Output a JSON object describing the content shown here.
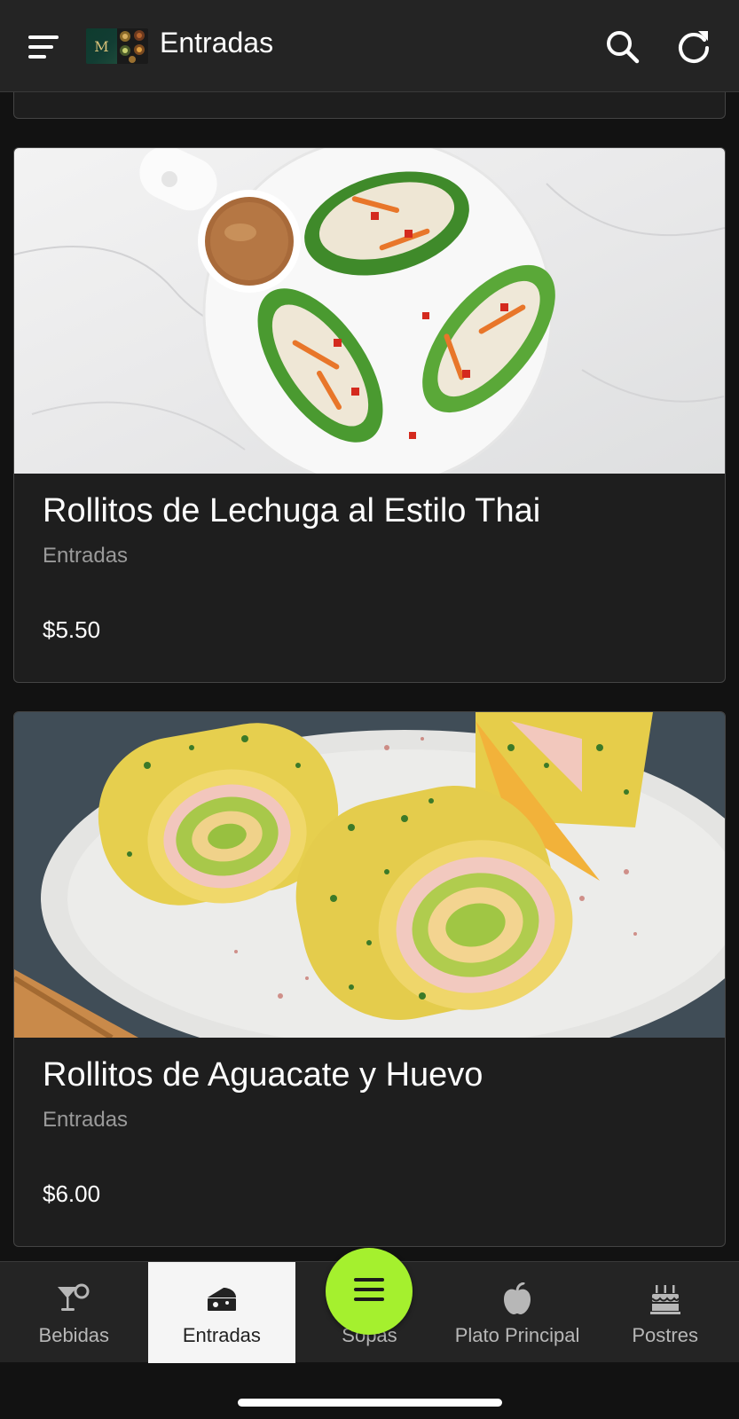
{
  "app_bar": {
    "title": "Entradas",
    "logo_letter": "M",
    "icons": {
      "menu": "menu-sort-icon",
      "search": "search-icon",
      "refresh": "refresh-icon"
    }
  },
  "products": [
    {
      "name": "Rollitos de Lechuga al Estilo Thai",
      "category": "Entradas",
      "price": "$5.50",
      "image": "lettuce-wraps-photo"
    },
    {
      "name": "Rollitos de Aguacate y Huevo",
      "category": "Entradas",
      "price": "$6.00",
      "image": "avocado-egg-rolls-photo"
    }
  ],
  "bottom_nav": {
    "items": [
      {
        "label": "Bebidas",
        "icon": "cocktail-icon",
        "active": false
      },
      {
        "label": "Entradas",
        "icon": "cheese-icon",
        "active": true
      },
      {
        "label": "Sopas",
        "icon": "soup-icon",
        "active": false
      },
      {
        "label": "Plato Principal",
        "icon": "apple-icon",
        "active": false
      },
      {
        "label": "Postres",
        "icon": "cake-icon",
        "active": false
      }
    ],
    "fab_icon": "menu-icon"
  },
  "colors": {
    "background": "#121212",
    "surface": "#1e1e1e",
    "app_bar": "#242424",
    "accent_fab": "#a5f02e",
    "active_tab": "#f5f5f5",
    "muted_text": "#9a9a9a"
  }
}
